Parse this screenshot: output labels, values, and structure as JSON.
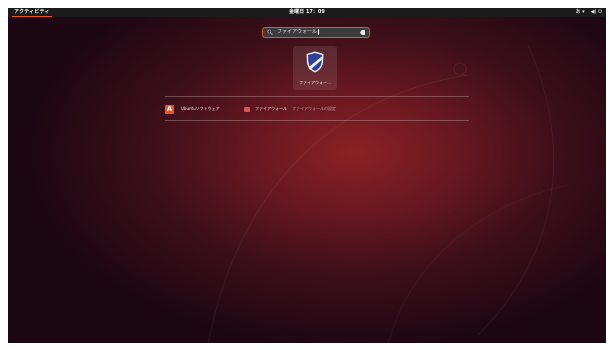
{
  "topbar": {
    "activities_label": "アクティビティ",
    "clock": "金曜日 17：09",
    "tray": [
      "あ ▾",
      "◀) ⏻"
    ]
  },
  "search": {
    "query": "ファイアウォール"
  },
  "app_grid": [
    {
      "label": "ファイアウォー…",
      "icon": "firewall-shield-icon"
    }
  ],
  "software_results": {
    "provider_label": "Ubuntuソフトウェア",
    "provider_icon": "ubuntu-software-icon",
    "items": [
      {
        "name": "ファイアウォール",
        "description": "ファイアウォールの設定",
        "icon": "firewall-app-icon"
      }
    ]
  },
  "colors": {
    "accent": "#e95420",
    "topbar": "#1b1b1b",
    "wallpaper_center": "#8a2224",
    "wallpaper_edge": "#1d0712"
  }
}
